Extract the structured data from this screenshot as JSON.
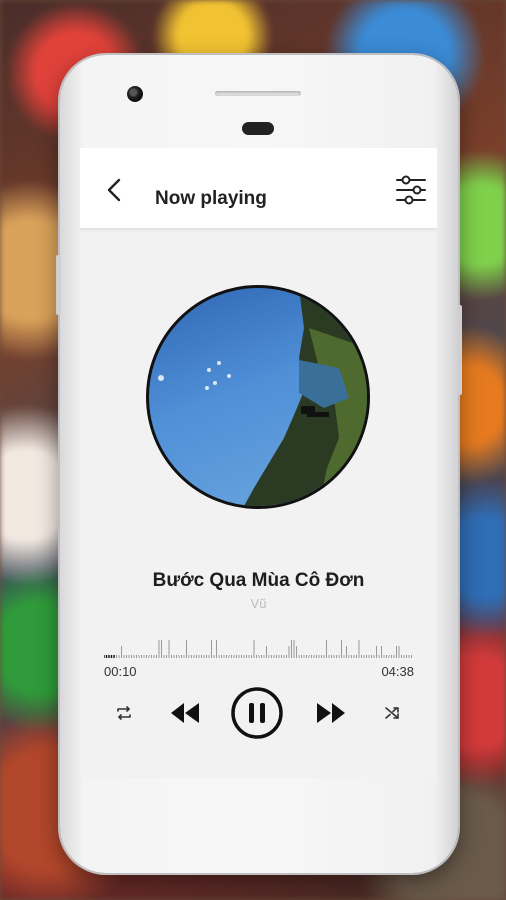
{
  "header": {
    "title": "Now playing",
    "back_icon": "back-chevron-icon",
    "equalizer_icon": "equalizer-sliders-icon"
  },
  "track": {
    "title": "Bước Qua Mùa Cô Đơn",
    "artist": "Vũ",
    "elapsed": "00:10",
    "duration": "04:38",
    "progress_fraction": 0.036
  },
  "controls": {
    "repeat_icon": "repeat-icon",
    "previous_icon": "rewind-icon",
    "play_pause_icon": "pause-icon",
    "next_icon": "fast-forward-icon",
    "shuffle_icon": "shuffle-icon"
  },
  "colors": {
    "accent": "#111111",
    "screen_background": "#f2f2f2",
    "topbar_background": "#ffffff"
  }
}
